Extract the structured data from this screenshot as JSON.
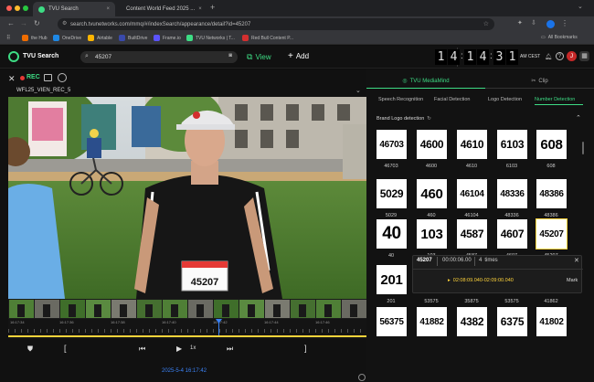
{
  "browser": {
    "tabs": [
      {
        "label": "TVU Search",
        "active": true
      },
      {
        "label": "Content World Feed 2025 ...",
        "active": false
      }
    ],
    "url": "search.tvunetworks.com/mmq/#/indexSearch/appearance/detail?id=45207",
    "bookmarks": [
      "the Hub",
      "OneDrive",
      "Airtable",
      "BuiltDrive",
      "Frame.io",
      "TVU Networks | T...",
      "Red Bull Content P..."
    ],
    "all_bookmarks": "All Bookmarks"
  },
  "app": {
    "name": "TVU Search",
    "search_value": "45207",
    "view_label": "View",
    "add_label": "Add",
    "clock": {
      "digits": [
        "1",
        "4",
        "1",
        "4",
        "3",
        "1"
      ],
      "suffix": "AM CEST"
    },
    "user_initial": "J"
  },
  "player": {
    "rec_label": "REC",
    "clip_name": "WFL25_VIEN_REC_5",
    "bib_text": "45207",
    "date_label": "2025-5-4 16:17:42",
    "speed_label": "1x",
    "timestamps": [
      "16:17:34",
      "16:17:36",
      "16:17:38",
      "16:17:40",
      "16:17:42",
      "16:17:44",
      "16:17:46"
    ]
  },
  "right": {
    "tabs": [
      {
        "label": "TVU MediaMind",
        "active": true
      },
      {
        "label": "Clip",
        "active": false
      }
    ],
    "subtabs": [
      "Speech Recognition",
      "Facial Detection",
      "Logo Detection",
      "Number Detection"
    ],
    "active_subtab": "Number Detection",
    "section_title": "Brand Logo detection",
    "rows": [
      [
        {
          "n": "46703",
          "c": "46703"
        },
        {
          "n": "4600",
          "c": "4600"
        },
        {
          "n": "4610",
          "c": "4610"
        },
        {
          "n": "6103",
          "c": "6103"
        },
        {
          "n": "608",
          "c": "608"
        }
      ],
      [
        {
          "n": "5029",
          "c": "5029"
        },
        {
          "n": "460",
          "c": "460"
        },
        {
          "n": "46104",
          "c": "46104"
        },
        {
          "n": "48336",
          "c": "48336"
        },
        {
          "n": "48386",
          "c": "48386"
        }
      ],
      [
        {
          "n": "40",
          "c": "40"
        },
        {
          "n": "103",
          "c": "103"
        },
        {
          "n": "4587",
          "c": "4587"
        },
        {
          "n": "4607",
          "c": "4607"
        },
        {
          "n": "45207",
          "c": "45207"
        }
      ],
      [
        {
          "n": "201",
          "c": "201"
        },
        {
          "n": "",
          "c": "53575"
        },
        {
          "n": "",
          "c": "35875"
        },
        {
          "n": "",
          "c": "53575"
        },
        {
          "n": "",
          "c": "41862"
        }
      ],
      [
        {
          "n": "56375",
          "c": ""
        },
        {
          "n": "41882",
          "c": ""
        },
        {
          "n": "4382",
          "c": ""
        },
        {
          "n": "6375",
          "c": ""
        },
        {
          "n": "41802",
          "c": ""
        }
      ]
    ],
    "selected_number": "45207"
  },
  "popup": {
    "number": "45207",
    "time": "00:00:06.00",
    "count": "4",
    "count_unit": "times",
    "range": "02:08:09.040-02:09:00.040",
    "mark_label": "Mark"
  },
  "colors": {
    "accent": "#3ddc84",
    "marker": "#ffd43b",
    "record": "#e53935"
  }
}
